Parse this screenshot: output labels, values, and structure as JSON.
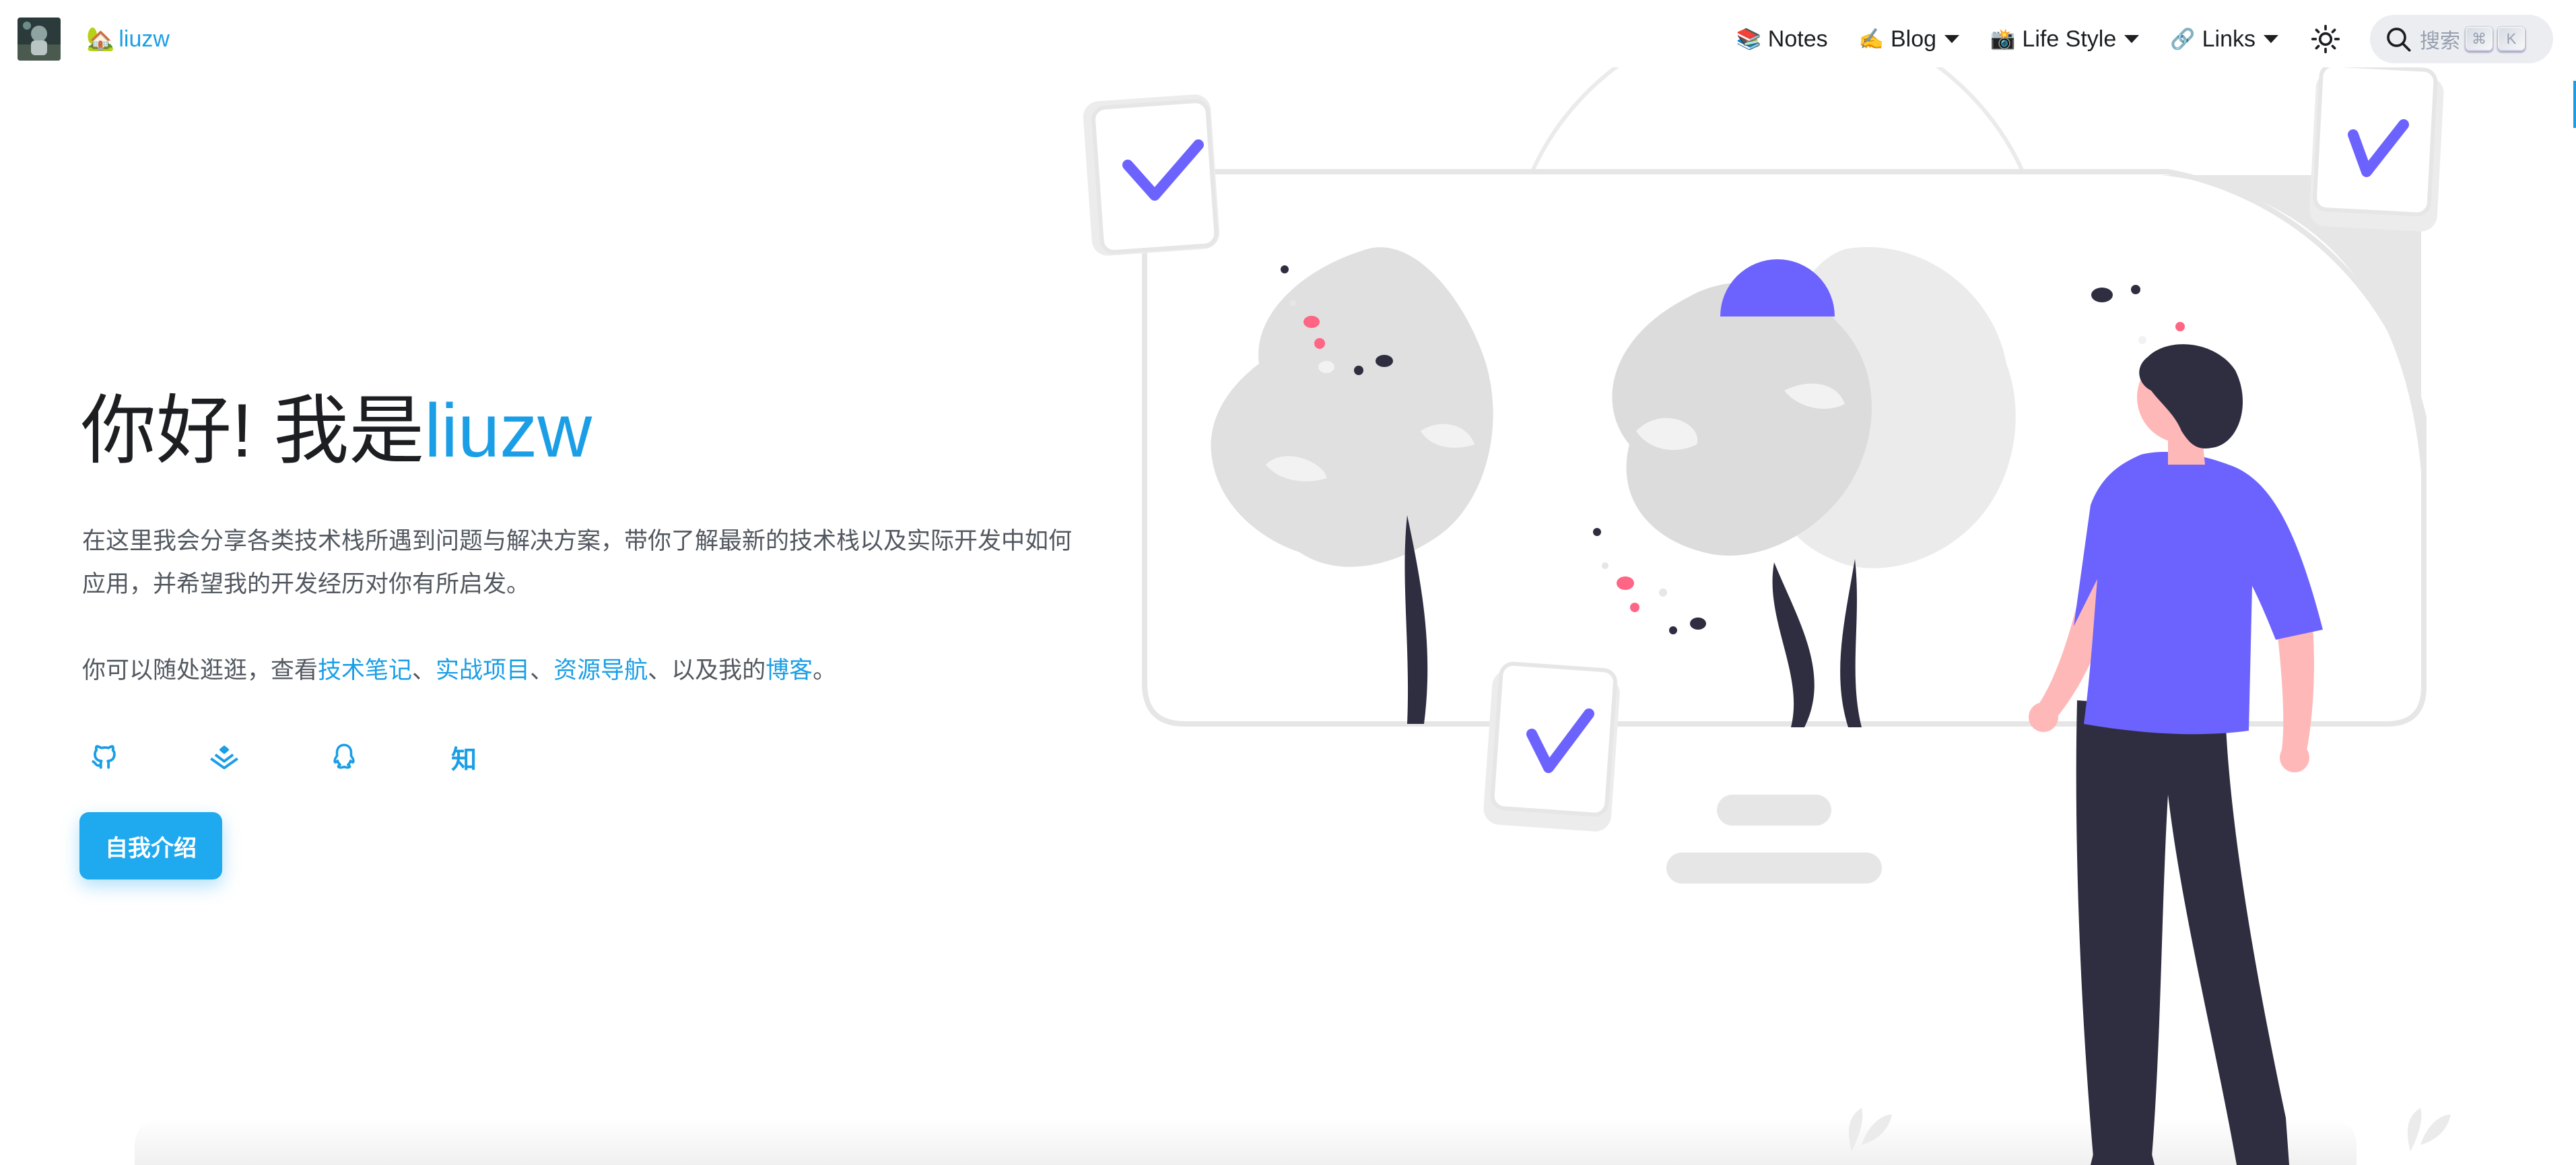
{
  "navbar": {
    "brand_emoji": "🏡",
    "brand": "liuzw",
    "items": [
      {
        "emoji": "📚",
        "label": "Notes",
        "dropdown": false
      },
      {
        "emoji": "✍️",
        "label": "Blog",
        "dropdown": true
      },
      {
        "emoji": "📸",
        "label": "Life Style",
        "dropdown": true
      },
      {
        "emoji": "🔗",
        "label": "Links",
        "dropdown": true
      }
    ],
    "theme_icon": "sun-icon",
    "search": {
      "placeholder": "搜索",
      "keys": [
        "⌘",
        "K"
      ]
    }
  },
  "hero": {
    "title_prefix": "你好! 我是",
    "title_name": "liuzw",
    "description": "在这里我会分享各类技术栈所遇到问题与解决方案，带你了解最新的技术栈以及实际开发中如何应用，并希望我的开发经历对你有所启发。",
    "explore_prefix": "你可以随处逛逛，查看",
    "links": [
      "技术笔记",
      "实战项目",
      "资源导航",
      "博客"
    ],
    "sep1": "、",
    "sep2": "、",
    "sep3": "、以及我的",
    "suffix": "。",
    "socials": [
      {
        "icon": "github-icon"
      },
      {
        "icon": "juejin-icon"
      },
      {
        "icon": "qq-icon"
      },
      {
        "icon": "zhihu-icon",
        "text": "知"
      }
    ],
    "intro_button": "自我介绍"
  },
  "colors": {
    "accent": "#1a9ee6",
    "illustration_accent": "#6c63ff",
    "pink": "#ff6584",
    "dark": "#2f2e41",
    "skin": "#ffb8b8"
  }
}
